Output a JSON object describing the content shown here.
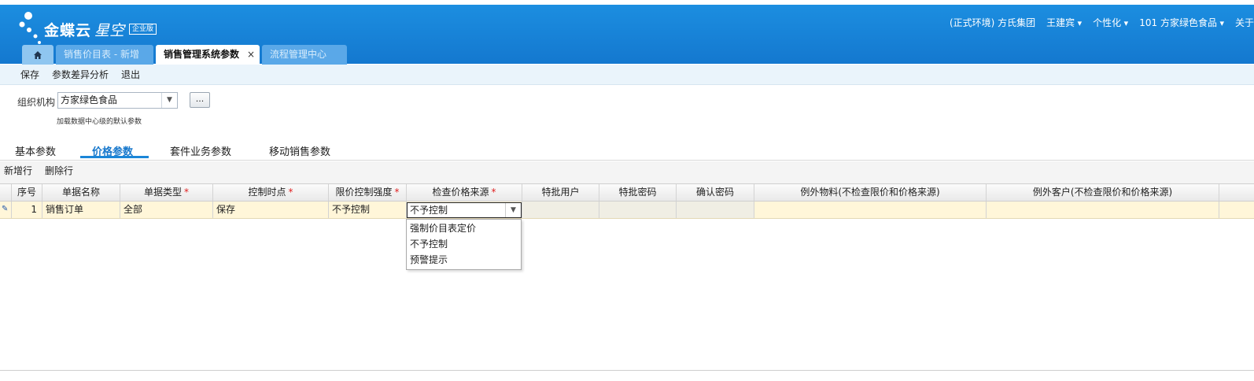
{
  "app": {
    "logo_text": "金蝶云",
    "logo_sub": "星空",
    "logo_badge": "企业版"
  },
  "header": {
    "env": "(正式环境) 方氏集团",
    "user": "王建宾",
    "personalize": "个性化",
    "org": "101  方家绿色食品",
    "about": "关于"
  },
  "tabs": {
    "home_icon": "home-icon",
    "t1": "销售价目表 - 新增",
    "t2": "销售管理系统参数",
    "t2_close": "×",
    "t3": "流程管理中心"
  },
  "toolbar": {
    "save": "保存",
    "diff": "参数差异分析",
    "exit": "退出"
  },
  "org": {
    "label": "组织机构",
    "value": "方家绿色食品",
    "more": "...",
    "hint": "加载数据中心级的默认参数"
  },
  "subtabs": {
    "basic": "基本参数",
    "price": "价格参数",
    "suite": "套件业务参数",
    "mobile": "移动销售参数"
  },
  "grid_toolbar": {
    "add_row": "新增行",
    "del_row": "删除行"
  },
  "grid": {
    "columns": [
      "序号",
      "单据名称",
      "单据类型",
      "控制时点",
      "限价控制强度",
      "检查价格来源",
      "特批用户",
      "特批密码",
      "确认密码",
      "例外物料(不检查限价和价格来源)",
      "例外客户(不检查限价和价格来源)"
    ],
    "required_mark": "*",
    "row": {
      "seq": "1",
      "bill_name": "销售订单",
      "bill_type": "全部",
      "control_point": "保存",
      "strength": "不予控制",
      "check_source": "不予控制",
      "user": "",
      "pwd": "",
      "confirm": "",
      "ex_material": "",
      "ex_customer": ""
    }
  },
  "dropdown": {
    "options": [
      "强制价目表定价",
      "不予控制",
      "预警提示"
    ]
  }
}
